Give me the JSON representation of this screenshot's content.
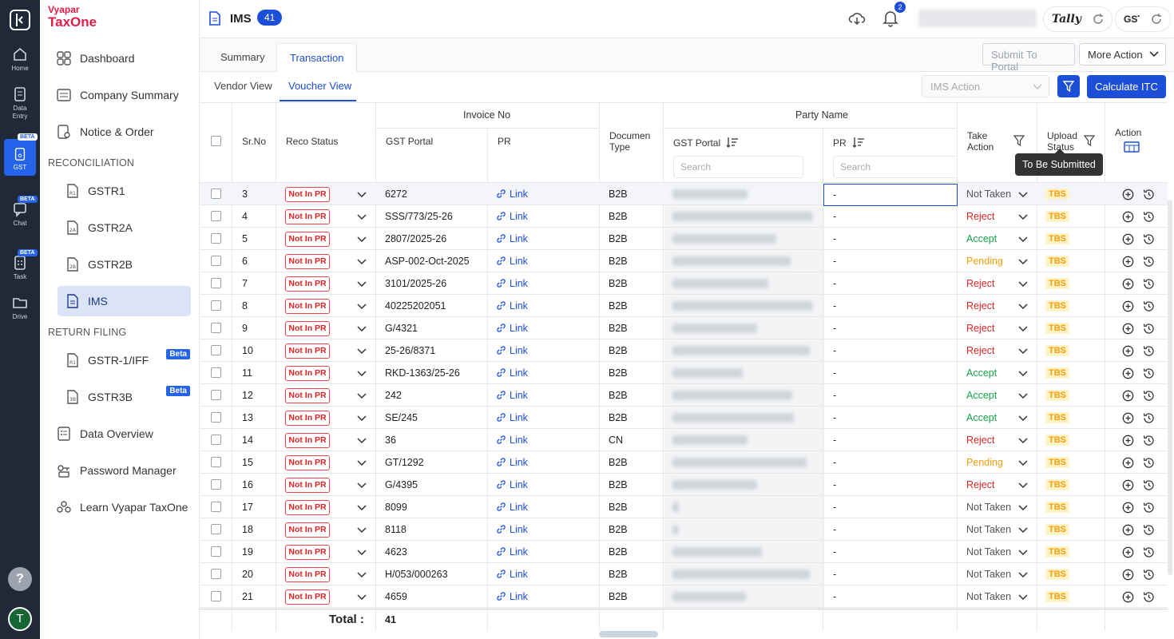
{
  "rail": {
    "items": [
      {
        "label": "Home"
      },
      {
        "label": "Data Entry"
      },
      {
        "label": "GST",
        "badge": "BETA"
      },
      {
        "label": "Chat",
        "badge": "BETA"
      },
      {
        "label": "Task",
        "badge": "BETA"
      },
      {
        "label": "Drive"
      }
    ],
    "help": "?",
    "avatar": "T"
  },
  "logo": {
    "line1": "Vyapar",
    "line2": "TaxOne"
  },
  "sidebar": {
    "dashboard": "Dashboard",
    "company_summary": "Company Summary",
    "notice_order": "Notice & Order",
    "reconciliation_heading": "RECONCILIATION",
    "gstr1": "GSTR1",
    "gstr2a": "GSTR2A",
    "gstr2b": "GSTR2B",
    "ims": "IMS",
    "return_filing_heading": "RETURN FILING",
    "gstr1_iff": "GSTR-1/IFF",
    "gstr1_iff_badge": "Beta",
    "gstr3b": "GSTR3B",
    "gstr3b_badge": "Beta",
    "data_overview": "Data Overview",
    "password_manager": "Password Manager",
    "learn": "Learn Vyapar TaxOne"
  },
  "header": {
    "title": "IMS",
    "count": "41",
    "notification_count": "2",
    "tally_label": "Tally",
    "gstn_label": "GSTN"
  },
  "tabs": {
    "summary": "Summary",
    "transaction": "Transaction"
  },
  "actions": {
    "submit_to_portal": "Submit To Portal",
    "more_action": "More Action",
    "ims_action_placeholder": "IMS Action",
    "calculate_itc": "Calculate ITC"
  },
  "subtabs": {
    "vendor_view": "Vendor View",
    "voucher_view": "Voucher View"
  },
  "table": {
    "headers": {
      "sr_no": "Sr.No",
      "reco_status": "Reco Status",
      "invoice_no": "Invoice No",
      "gst_portal": "GST Portal",
      "pr": "PR",
      "document_type_1": "Documen",
      "document_type_2": "Type",
      "party_name": "Party Name",
      "party_gst_portal": "GST Portal",
      "party_pr": "PR",
      "take_action_1": "Take",
      "take_action_2": "Action",
      "upload_status_1": "Upload",
      "upload_status_2": "Status",
      "action": "Action",
      "search_placeholder": "Search"
    },
    "link_label": "Link",
    "reco_label": "Not In PR",
    "dash": "-",
    "tbs": "TBS",
    "rows": [
      {
        "sr": "3",
        "invoice": "6272",
        "doc": "B2B",
        "action": "Not Taken",
        "kind": "none"
      },
      {
        "sr": "4",
        "invoice": "SSS/773/25-26",
        "doc": "B2B",
        "action": "Reject",
        "kind": "reject"
      },
      {
        "sr": "5",
        "invoice": "2807/2025-26",
        "doc": "B2B",
        "action": "Accept",
        "kind": "accept"
      },
      {
        "sr": "6",
        "invoice": "ASP-002-Oct-2025",
        "doc": "B2B",
        "action": "Pending",
        "kind": "pending"
      },
      {
        "sr": "7",
        "invoice": "3101/2025-26",
        "doc": "B2B",
        "action": "Reject",
        "kind": "reject"
      },
      {
        "sr": "8",
        "invoice": "40225202051",
        "doc": "B2B",
        "action": "Reject",
        "kind": "reject"
      },
      {
        "sr": "9",
        "invoice": "G/4321",
        "doc": "B2B",
        "action": "Reject",
        "kind": "reject"
      },
      {
        "sr": "10",
        "invoice": "25-26/8371",
        "doc": "B2B",
        "action": "Reject",
        "kind": "reject"
      },
      {
        "sr": "11",
        "invoice": "RKD-1363/25-26",
        "doc": "B2B",
        "action": "Accept",
        "kind": "accept"
      },
      {
        "sr": "12",
        "invoice": "242",
        "doc": "B2B",
        "action": "Accept",
        "kind": "accept"
      },
      {
        "sr": "13",
        "invoice": "SE/245",
        "doc": "B2B",
        "action": "Accept",
        "kind": "accept"
      },
      {
        "sr": "14",
        "invoice": "36",
        "doc": "CN",
        "action": "Reject",
        "kind": "reject"
      },
      {
        "sr": "15",
        "invoice": "GT/1292",
        "doc": "B2B",
        "action": "Pending",
        "kind": "pending"
      },
      {
        "sr": "16",
        "invoice": "G/4395",
        "doc": "B2B",
        "action": "Reject",
        "kind": "reject"
      },
      {
        "sr": "17",
        "invoice": "8099",
        "doc": "B2B",
        "action": "Not Taken",
        "kind": "none"
      },
      {
        "sr": "18",
        "invoice": "8118",
        "doc": "B2B",
        "action": "Not Taken",
        "kind": "none"
      },
      {
        "sr": "19",
        "invoice": "4623",
        "doc": "B2B",
        "action": "Not Taken",
        "kind": "none"
      },
      {
        "sr": "20",
        "invoice": "H/053/000263",
        "doc": "B2B",
        "action": "Not Taken",
        "kind": "none"
      },
      {
        "sr": "21",
        "invoice": "4659",
        "doc": "B2B",
        "action": "Not Taken",
        "kind": "none"
      }
    ],
    "total_label": "Total :",
    "total_value": "41"
  },
  "tooltip": "To Be Submitted",
  "colors": {
    "accent": "#1d4ed8",
    "reject": "#dc2626",
    "accept": "#16a34a",
    "pending": "#f59e0b",
    "rail": "#1f2937"
  }
}
